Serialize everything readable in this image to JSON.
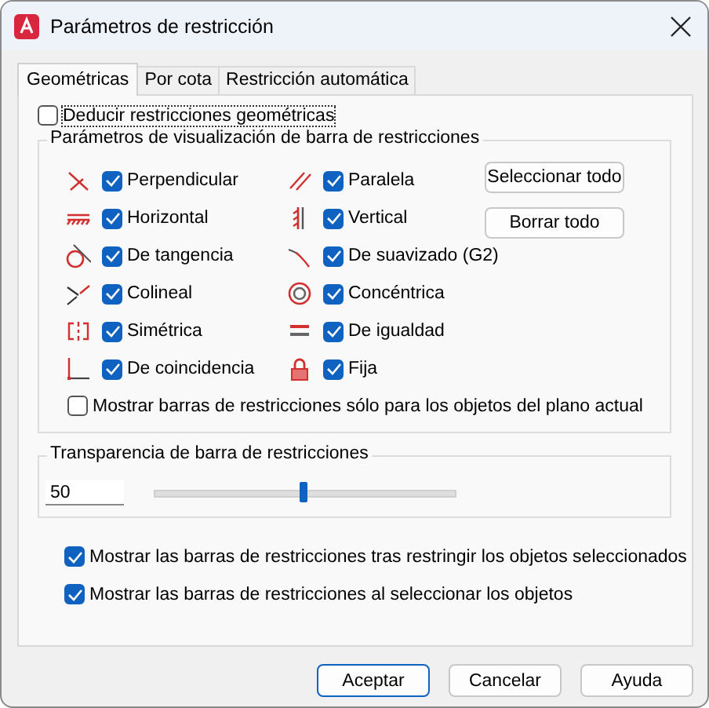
{
  "window": {
    "title": "Parámetros de restricción"
  },
  "tabs": [
    {
      "label": "Geométricas",
      "selected": true
    },
    {
      "label": "Por cota",
      "selected": false
    },
    {
      "label": "Restricción automática",
      "selected": false
    }
  ],
  "infer": {
    "label": "Deducir restricciones geométricas",
    "checked": false
  },
  "display_group": {
    "title": "Parámetros de visualización de barra de restricciones",
    "constraints": [
      {
        "kind": "perpendicular",
        "label": "Perpendicular",
        "checked": true
      },
      {
        "kind": "parallel",
        "label": "Paralela",
        "checked": true
      },
      {
        "kind": "horizontal",
        "label": "Horizontal",
        "checked": true
      },
      {
        "kind": "vertical",
        "label": "Vertical",
        "checked": true
      },
      {
        "kind": "tangent",
        "label": "De tangencia",
        "checked": true
      },
      {
        "kind": "smooth",
        "label": "De suavizado (G2)",
        "checked": true
      },
      {
        "kind": "collinear",
        "label": "Colineal",
        "checked": true
      },
      {
        "kind": "concentric",
        "label": "Concéntrica",
        "checked": true
      },
      {
        "kind": "symmetric",
        "label": "Simétrica",
        "checked": true
      },
      {
        "kind": "equal",
        "label": "De igualdad",
        "checked": true
      },
      {
        "kind": "coincident",
        "label": "De coincidencia",
        "checked": true
      },
      {
        "kind": "fix",
        "label": "Fija",
        "checked": true
      }
    ],
    "buttons": [
      "Seleccionar todo",
      "Borrar todo"
    ],
    "plane_only": {
      "label": "Mostrar barras de restricciones sólo para los objetos del plano actual",
      "checked": false
    }
  },
  "transparency": {
    "title": "Transparencia de barra de restricciones",
    "value": "50",
    "level": 0.5
  },
  "options": [
    {
      "label": "Mostrar las barras de restricciones tras restringir los objetos seleccionados",
      "checked": true
    },
    {
      "label": "Mostrar las barras de restricciones al seleccionar los objetos",
      "checked": true
    }
  ],
  "buttons": [
    {
      "label": "Aceptar",
      "default": true
    },
    {
      "label": "Cancelar",
      "default": false
    },
    {
      "label": "Ayuda",
      "default": false
    }
  ]
}
